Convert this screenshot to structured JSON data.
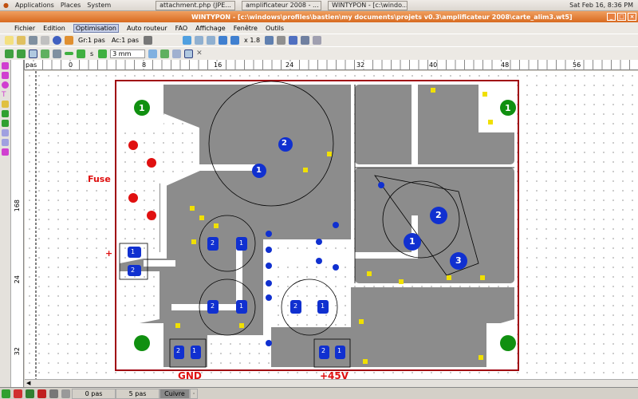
{
  "panel": {
    "menus": [
      "Applications",
      "Places",
      "System"
    ],
    "tasks": [
      "attachment.php (JPE...",
      "amplificateur 2008 - ...",
      "WINTYPON - [c:\\windo..."
    ],
    "clock": "Sat Feb 16,  8:36 PM"
  },
  "window": {
    "title": "WINTYPON - [c:\\windows\\profiles\\bastien\\my documents\\projets v0.3\\amplificateur 2008\\carte_alim3.wt5]"
  },
  "menu": [
    "Fichier",
    "Edition",
    "Optimisation",
    "Auto routeur",
    "FAO",
    "Affichage",
    "Fenêtre",
    "Outils"
  ],
  "toolbar1": {
    "grid": "Gr:1 pas",
    "snap": "Ac:1 pas",
    "zoom": "x 1.8"
  },
  "toolbar2": {
    "layer": "s",
    "width": "3 mm"
  },
  "ruler": {
    "unit": "pas",
    "h": [
      "0",
      "8",
      "16",
      "24",
      "32",
      "40",
      "48",
      "56"
    ],
    "v": [
      "8",
      "16",
      "24",
      "32"
    ]
  },
  "board": {
    "fuse": "Fuse",
    "plus": "+",
    "gnd": "GND",
    "v45": "+45V",
    "pads": {
      "one": "1",
      "two": "2",
      "three": "3"
    }
  },
  "status": {
    "x": "0 pas",
    "y": "5 pas",
    "mode": "Cuivre"
  },
  "colors": {
    "copper": "#8c8c8c",
    "pad": "#1030d0",
    "yellow": "#f0e000",
    "border": "#a00010"
  }
}
